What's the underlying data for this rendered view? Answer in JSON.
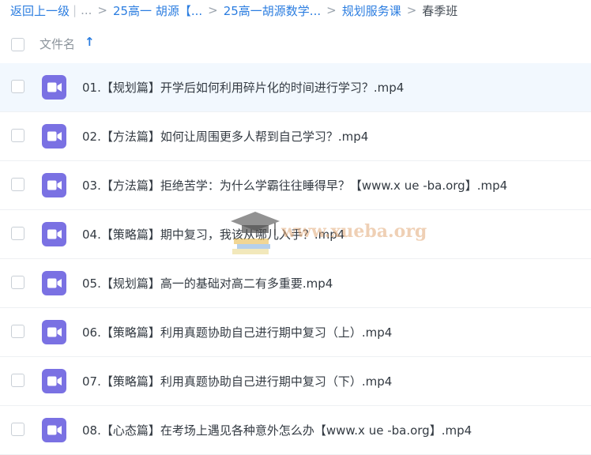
{
  "breadcrumb": {
    "back_label": "返回上一级",
    "ellipsis": "...",
    "path": [
      {
        "label": "25高一 胡源【..."
      },
      {
        "label": "25高一胡源数学..."
      },
      {
        "label": "规划服务课"
      }
    ],
    "current": "春季班"
  },
  "table": {
    "column_title": "文件名",
    "sort_icon": "arrow-up-icon",
    "file_icon": "video-camera-icon",
    "icon_color": "#7a71e3",
    "rows": [
      {
        "name": "01.【规划篇】开学后如何利用碎片化的时间进行学习？.mp4",
        "selected": true
      },
      {
        "name": "02.【方法篇】如何让周围更多人帮到自己学习？.mp4",
        "selected": false
      },
      {
        "name": "03.【方法篇】拒绝苦学：为什么学霸往往睡得早？【www.x ue -ba.org】.mp4",
        "selected": false
      },
      {
        "name": "04.【策略篇】期中复习，我该从哪儿入手？.mp4",
        "selected": false
      },
      {
        "name": "05.【规划篇】高一的基础对高二有多重要.mp4",
        "selected": false
      },
      {
        "name": "06.【策略篇】利用真题协助自己进行期中复习（上）.mp4",
        "selected": false
      },
      {
        "name": "07.【策略篇】利用真题协助自己进行期中复习（下）.mp4",
        "selected": false
      },
      {
        "name": "08.【心态篇】在考场上遇见各种意外怎么办【www.x ue -ba.org】.mp4",
        "selected": false
      }
    ]
  },
  "watermark": {
    "text": "www.xueba.org",
    "icon": "graduation-cap-icon"
  },
  "colors": {
    "link": "#2b7de0",
    "selected_row": "#f2f8fe"
  }
}
